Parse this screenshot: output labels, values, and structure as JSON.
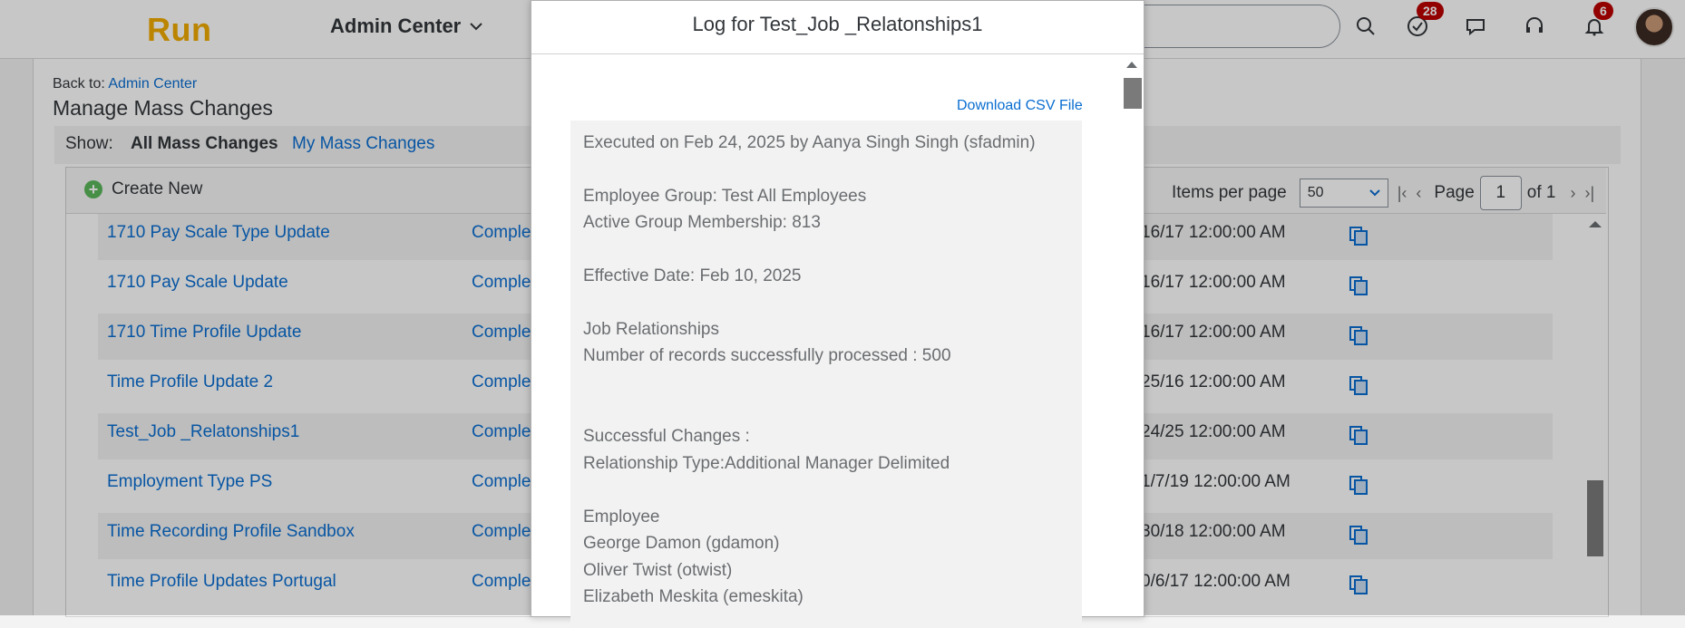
{
  "shell": {
    "logo": "Run",
    "app_menu": "Admin Center",
    "badges": {
      "todo": "28",
      "notifications": "6"
    },
    "icons": [
      "search-icon",
      "todo-icon",
      "chat-icon",
      "headset-icon",
      "bell-icon"
    ]
  },
  "page": {
    "back_label": "Back to:",
    "back_link": "Admin Center",
    "title": "Manage Mass Changes",
    "show_label": "Show:",
    "show_all": "All Mass Changes",
    "show_mine": "My Mass Changes",
    "create_new": "Create New",
    "items_per_page_label": "Items per page",
    "items_per_page_value": "50",
    "page_label": "Page",
    "page_value": "1",
    "page_of": "of 1"
  },
  "rows": [
    {
      "name": "1710 Pay Scale Type Update",
      "status": "Comple",
      "date": "16/17 12:00:00 AM"
    },
    {
      "name": "1710 Pay Scale Update",
      "status": "Comple",
      "date": "16/17 12:00:00 AM"
    },
    {
      "name": "1710 Time Profile Update",
      "status": "Comple",
      "date": "16/17 12:00:00 AM"
    },
    {
      "name": "Time Profile Update 2",
      "status": "Comple",
      "date": "25/16 12:00:00 AM"
    },
    {
      "name": "Test_Job _Relatonships1",
      "status": "Comple",
      "date": "24/25 12:00:00 AM"
    },
    {
      "name": "Employment Type PS",
      "status": "Comple",
      "date": "1/7/19 12:00:00 AM"
    },
    {
      "name": "Time Recording Profile Sandbox",
      "status": "Comple",
      "date": "30/18 12:00:00 AM"
    },
    {
      "name": "Time Profile Updates Portugal",
      "status": "Comple",
      "date": "0/6/17 12:00:00 AM"
    }
  ],
  "dialog": {
    "title": "Log for Test_Job _Relatonships1",
    "download_link": "Download CSV File",
    "log_lines": [
      "Executed on Feb 24, 2025 by Aanya Singh Singh (sfadmin)",
      "Employee Group: Test All Employees",
      "Active Group Membership: 813",
      "Effective Date: Feb 10, 2025",
      "Job Relationships",
      "Number of records successfully processed : 500",
      "Successful Changes :",
      "Relationship Type:Additional Manager Delimited",
      "Employee",
      "George Damon (gdamon)",
      "Oliver Twist (otwist)",
      "Elizabeth Meskita (emeskita)"
    ]
  }
}
